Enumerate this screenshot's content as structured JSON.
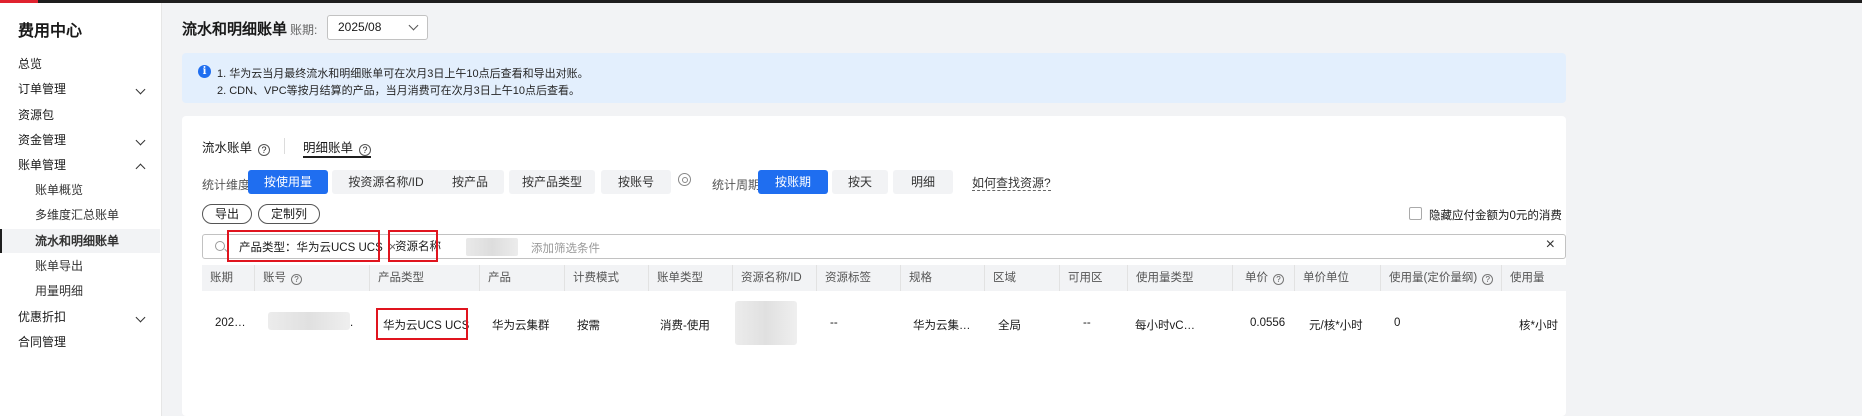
{
  "sidebar": {
    "title": "费用中心",
    "items": [
      {
        "label": "总览"
      },
      {
        "label": "订单管理"
      },
      {
        "label": "资源包"
      },
      {
        "label": "资金管理"
      },
      {
        "label": "账单管理"
      },
      {
        "label": "账单概览"
      },
      {
        "label": "多维度汇总账单"
      },
      {
        "label": "流水和明细账单"
      },
      {
        "label": "账单导出"
      },
      {
        "label": "用量明细"
      },
      {
        "label": "优惠折扣"
      },
      {
        "label": "合同管理"
      }
    ]
  },
  "header": {
    "title": "流水和明细账单",
    "period_label": "账期:",
    "period_value": "2025/08"
  },
  "notice": {
    "line1": "1. 华为云当月最终流水和明细账单可在次月3日上午10点后查看和导出对账。",
    "line2": "2. CDN、VPC等按月结算的产品，当月消费可在次月3日上午10点后查看。"
  },
  "tabs": [
    {
      "label": "流水账单"
    },
    {
      "label": "明细账单"
    }
  ],
  "dimension": {
    "label": "统计维度",
    "options": [
      "按使用量",
      "按资源名称/ID",
      "按产品",
      "按产品类型",
      "按账号"
    ],
    "selected": "按使用量"
  },
  "period": {
    "label": "统计周期",
    "options": [
      "按账期",
      "按天",
      "明细"
    ],
    "selected": "按账期"
  },
  "help_link": "如何查找资源?",
  "actions": {
    "export": "导出",
    "custom_columns": "定制列"
  },
  "hide_zero": "隐藏应付金额为0元的消费",
  "filter": {
    "chip1": "产品类型：华为云UCS UCS",
    "chip2": "资源名称",
    "placeholder": "添加筛选条件"
  },
  "table": {
    "headers": [
      "账期",
      "账号",
      "产品类型",
      "产品",
      "计费模式",
      "账单类型",
      "资源名称/ID",
      "资源标签",
      "规格",
      "区域",
      "可用区",
      "使用量类型",
      "单价",
      "单价单位",
      "使用量(定价量纲)",
      "使用量"
    ],
    "row": {
      "period": "202…",
      "account_suffix": ".",
      "product_type": "华为云UCS UCS",
      "product": "华为云集群",
      "billing_mode": "按需",
      "bill_type": "消费-使用",
      "tag": "--",
      "spec": "华为云集…",
      "region": "全局",
      "az": "--",
      "usage_type": "每小时vC…",
      "unit_price": "0.0556",
      "price_unit": "元/核*小时",
      "usage_pricing": "0",
      "usage_unit": "核*小时"
    }
  }
}
